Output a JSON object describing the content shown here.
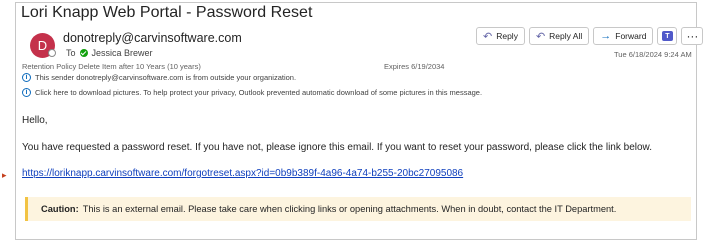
{
  "email": {
    "subject": "Lori Knapp Web Portal - Password Reset",
    "avatar_initial": "D",
    "sender": "donotreply@carvinsoftware.com",
    "to_label": "To",
    "recipient": "Jessica Brewer",
    "retention": "Retention Policy  Delete Item after 10 Years (10 years)",
    "expires": "Expires  6/19/2034",
    "external_notice": "This sender donotreply@carvinsoftware.com is from outside your organization.",
    "download_notice": "Click here to download pictures. To help protect your privacy, Outlook prevented automatic download of some pictures in this message.",
    "date": "Tue 6/18/2024 9:24 AM"
  },
  "actions": {
    "reply": "Reply",
    "reply_all": "Reply All",
    "forward": "Forward",
    "more": "···"
  },
  "body": {
    "greeting": "Hello,",
    "message": "You have requested a password reset. If you have not, please ignore this email. If you want to reset your password, please click the link below.",
    "link": "https://loriknapp.carvinsoftware.com/forgotreset.aspx?id=0b9b389f-4a96-4a74-b255-20bc27095086",
    "caution_label": "Caution:",
    "caution_text": "This is an external email. Please take care when clicking links or opening attachments. When in doubt, contact the IT Department."
  },
  "icons": {
    "reply": "reply-icon",
    "reply_all": "reply-all-icon",
    "forward": "forward-icon",
    "teams": "teams-icon",
    "info": "info-icon"
  },
  "colors": {
    "avatar": "#c4314b",
    "link": "#0f3fbd",
    "caution_bg": "#fdf4df",
    "caution_border": "#f2c343"
  }
}
